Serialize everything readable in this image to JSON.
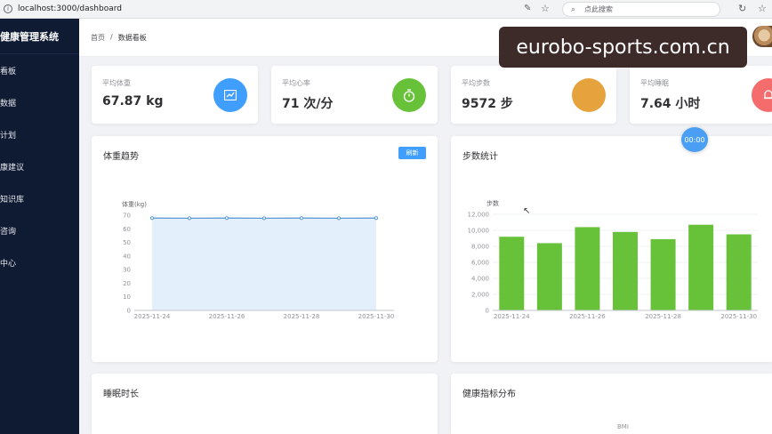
{
  "browser": {
    "url": "localhost:3000/dashboard",
    "search_placeholder": "点此搜索"
  },
  "sidebar": {
    "brand": "健康管理系统",
    "items": [
      {
        "label": "看板"
      },
      {
        "label": "数据"
      },
      {
        "label": "计划"
      },
      {
        "label": "康建议"
      },
      {
        "label": "知识库"
      },
      {
        "label": "咨询"
      },
      {
        "label": "中心"
      }
    ]
  },
  "header": {
    "breadcrumb": [
      "首页",
      "/",
      "数据看板"
    ]
  },
  "watermark": "eurobo-sports.com.cn",
  "stats": [
    {
      "label": "平均体重",
      "value": "67.87 kg",
      "color": "#409eff",
      "icon": "trend-chart-icon"
    },
    {
      "label": "平均心率",
      "value": "71 次/分",
      "color": "#67c23a",
      "icon": "stopwatch-icon"
    },
    {
      "label": "平均步数",
      "value": "9572 步",
      "color": "#e6a23c",
      "icon": "footprint-icon"
    },
    {
      "label": "平均睡眠",
      "value": "7.64 小时",
      "color": "#f56c6c",
      "icon": "alarm-icon"
    }
  ],
  "weight_panel": {
    "title": "体重趋势",
    "refresh_label": "刷新"
  },
  "steps_panel": {
    "title": "步数统计"
  },
  "sleep_panel": {
    "title": "睡眠时长"
  },
  "health_panel": {
    "title": "健康指标分布",
    "partial_label": "BMI"
  },
  "float_badge": "00:00",
  "chart_data": [
    {
      "type": "area",
      "ylabel": "体重(kg)",
      "ylim": [
        0,
        70
      ],
      "yticks": [
        0,
        10,
        20,
        30,
        40,
        50,
        60,
        70
      ],
      "x": [
        "2025-11-24",
        "2025-11-25",
        "2025-11-26",
        "2025-11-27",
        "2025-11-28",
        "2025-11-29",
        "2025-11-30"
      ],
      "xtick_labels": [
        "2025-11-24",
        "2025-11-26",
        "2025-11-28",
        "2025-11-30"
      ],
      "values": [
        67.9,
        67.8,
        67.9,
        67.8,
        67.9,
        67.8,
        67.9
      ],
      "color": "#5b9bd5",
      "fill": "#e3effb"
    },
    {
      "type": "bar",
      "ylabel": "步数",
      "ylim": [
        0,
        12000
      ],
      "yticks": [
        0,
        2000,
        4000,
        6000,
        8000,
        10000,
        12000
      ],
      "ytick_labels": [
        "0",
        "2,000",
        "4,000",
        "6,000",
        "8,000",
        "10,000",
        "12,000"
      ],
      "categories": [
        "2025-11-24",
        "2025-11-25",
        "2025-11-26",
        "2025-11-27",
        "2025-11-28",
        "2025-11-29",
        "2025-11-30"
      ],
      "xtick_labels": [
        "2025-11-24",
        "2025-11-26",
        "2025-11-28",
        "2025-11-30"
      ],
      "values": [
        9200,
        8400,
        10400,
        9800,
        8900,
        10700,
        9500
      ],
      "color": "#67c23a"
    }
  ]
}
